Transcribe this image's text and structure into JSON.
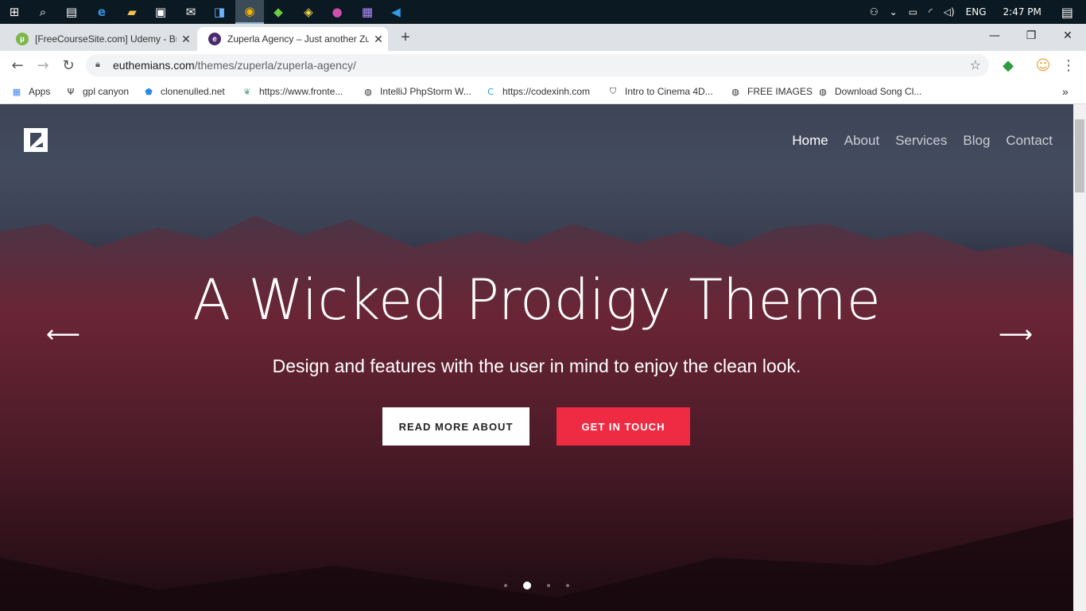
{
  "taskbar": {
    "tray": {
      "language": "ENG",
      "time": "2:47 PM"
    }
  },
  "tabs": [
    {
      "title": "[FreeCourseSite.com] Udemy - Bu",
      "favicon_color": "#7ab648"
    },
    {
      "title": "Zuperla Agency – Just another Zu",
      "favicon_color": "#4a2b6e"
    }
  ],
  "address": {
    "host": "euthemians.com",
    "path": "/themes/zuperla/zuperla-agency/"
  },
  "bookmarks": [
    {
      "label": "Apps",
      "icon": "apps-grid-icon"
    },
    {
      "label": "gpl canyon",
      "icon": "fork-icon"
    },
    {
      "label": "clonenulled.net",
      "icon": "shield-icon"
    },
    {
      "label": "https://www.fronte...",
      "icon": "leaf-icon"
    },
    {
      "label": "IntelliJ PhpStorm W...",
      "icon": "globe-icon"
    },
    {
      "label": "https://codexinh.com",
      "icon": "c-logo-icon"
    },
    {
      "label": "Intro to Cinema 4D...",
      "icon": "shield-dark-icon"
    },
    {
      "label": "FREE IMAGES",
      "icon": "globe-icon"
    },
    {
      "label": "Download Song Cl...",
      "icon": "globe-icon"
    }
  ],
  "site": {
    "nav": [
      "Home",
      "About",
      "Services",
      "Blog",
      "Contact"
    ],
    "hero": {
      "title": "A Wicked Prodigy Theme",
      "subtitle": "Design and features with the user in mind to enjoy the clean look.",
      "btn_read": "READ MORE ABOUT",
      "btn_touch": "GET IN TOUCH"
    },
    "slider": {
      "total": 4,
      "active": 2
    },
    "accent": "#ef2b43"
  }
}
